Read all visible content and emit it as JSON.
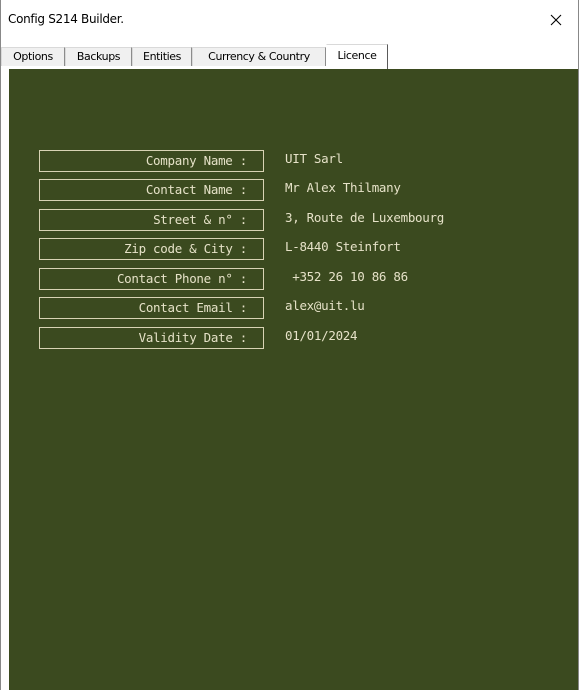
{
  "window": {
    "title": "Config S214 Builder."
  },
  "tabs": [
    {
      "label": "Options",
      "active": false
    },
    {
      "label": "Backups",
      "active": false
    },
    {
      "label": "Entities",
      "active": false
    },
    {
      "label": "Currency & Country",
      "active": false
    },
    {
      "label": "Licence",
      "active": true
    }
  ],
  "licence": {
    "fields": [
      {
        "label": "Company Name :",
        "value": "UIT Sarl"
      },
      {
        "label": "Contact Name :",
        "value": "Mr Alex Thilmany"
      },
      {
        "label": "Street & n° :",
        "value": "3, Route de Luxembourg"
      },
      {
        "label": "Zip code & City :",
        "value": "L-8440 Steinfort"
      },
      {
        "label": "Contact Phone n° :",
        "value": " +352 26 10 86 86"
      },
      {
        "label": "Contact Email :",
        "value": "alex@uit.lu"
      },
      {
        "label": "Validity Date :",
        "value": "01/01/2024"
      }
    ]
  },
  "colors": {
    "panel_background": "#3b4a1f",
    "text": "#e6e2c8",
    "label_border": "#d8d3b4"
  },
  "icons": {
    "close": "close-icon"
  }
}
